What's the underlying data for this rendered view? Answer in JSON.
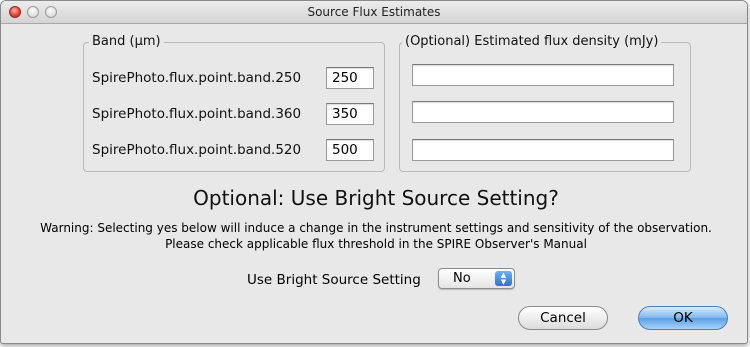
{
  "window": {
    "title": "Source Flux Estimates"
  },
  "band_group": {
    "label": "Band (µm)",
    "rows": [
      {
        "label": "SpirePhoto.flux.point.band.250",
        "value": "250"
      },
      {
        "label": "SpirePhoto.flux.point.band.360",
        "value": "350"
      },
      {
        "label": "SpirePhoto.flux.point.band.520",
        "value": "500"
      }
    ]
  },
  "flux_group": {
    "label": "(Optional) Estimated flux density (mJy)",
    "fields": [
      "",
      "",
      ""
    ]
  },
  "bright": {
    "heading": "Optional: Use Bright Source Setting?",
    "warning_line1": "Warning: Selecting yes below will induce a change in the instrument settings and sensitivity of the observation.",
    "warning_line2": "Please check applicable flux threshold in the SPIRE Observer's Manual",
    "setting_label": "Use Bright Source Setting",
    "setting_value": "No"
  },
  "buttons": {
    "cancel": "Cancel",
    "ok": "OK"
  }
}
